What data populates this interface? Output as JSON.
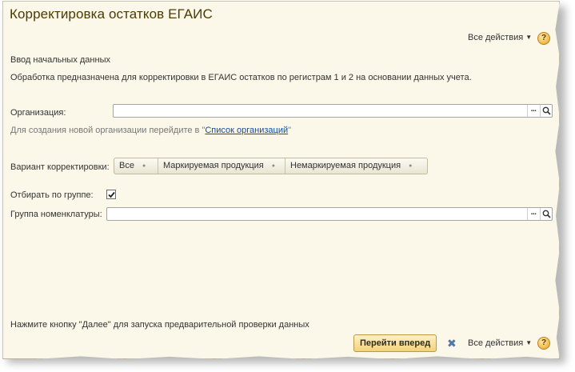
{
  "window": {
    "title": "Корректировка остатков ЕГАИС"
  },
  "top_actions": {
    "all_actions_label": "Все действия",
    "help_label": "?"
  },
  "intro": {
    "heading": "Ввод начальных данных",
    "description": "Обработка предназначена для корректировки в ЕГАИС остатков по регистрам 1 и 2 на основании данных учета."
  },
  "organization": {
    "label": "Организация:",
    "value": "",
    "select_button": "...",
    "hint_prefix": "Для создания новой организации перейдите в \"",
    "hint_link": "Список организаций",
    "hint_suffix": "\""
  },
  "correction_variant": {
    "label": "Вариант корректировки:",
    "options": [
      "Все",
      "Маркируемая продукция",
      "Немаркируемая продукция"
    ]
  },
  "filter_by_group": {
    "label": "Отбирать по группе:",
    "checked": true
  },
  "nomenclature_group": {
    "label": "Группа номенклатуры:",
    "value": "",
    "select_button": "..."
  },
  "footer": {
    "instruction": "Нажмите кнопку \"Далее\" для запуска предварительной проверки данных",
    "next_button": "Перейти вперед",
    "all_actions_label": "Все действия",
    "help_label": "?"
  }
}
